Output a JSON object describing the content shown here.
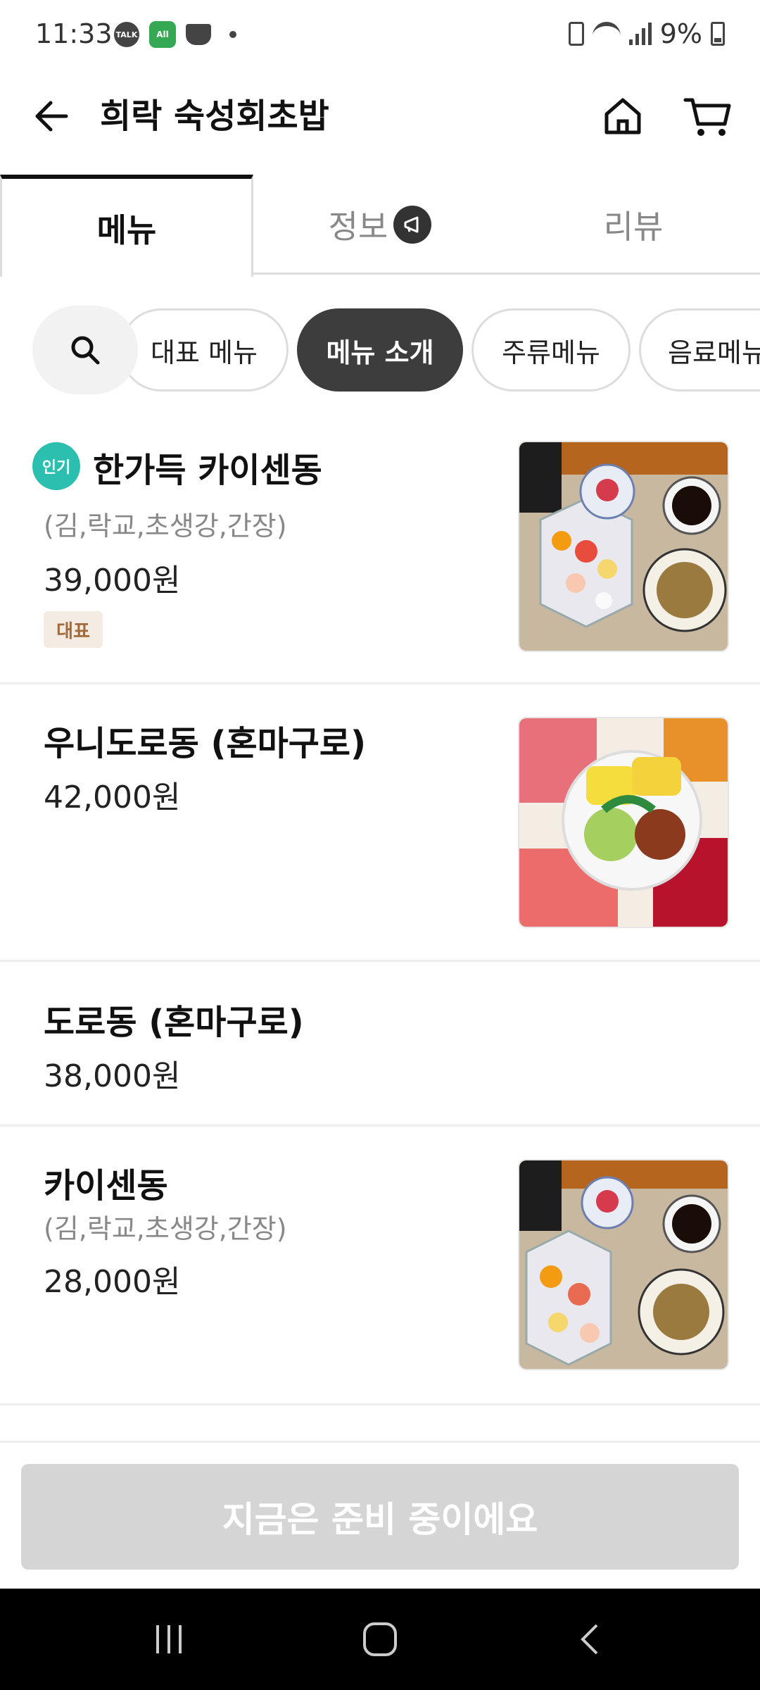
{
  "status_bar": {
    "time": "11:33",
    "talk_label": "TALK",
    "app_label": "All",
    "battery": "9%",
    "icons": [
      "talk-icon",
      "app-icon",
      "coffee-icon",
      "dot-icon",
      "battery-saver-icon",
      "wifi-icon",
      "signal-icon",
      "battery-icon"
    ]
  },
  "header": {
    "title": "희락 숙성회초밥",
    "icons": [
      "back-arrow-icon",
      "home-icon",
      "cart-icon"
    ]
  },
  "tabs": [
    {
      "label": "메뉴",
      "active": true
    },
    {
      "label": "정보",
      "active": false,
      "icon": "megaphone-icon"
    },
    {
      "label": "리뷰",
      "active": false
    }
  ],
  "chips": {
    "search_icon": "search-icon",
    "items": [
      {
        "label": "대표 메뉴",
        "active": false
      },
      {
        "label": "메뉴 소개",
        "active": true
      },
      {
        "label": "주류메뉴",
        "active": false
      },
      {
        "label": "음료메뉴",
        "active": false
      }
    ]
  },
  "menu": [
    {
      "badge": "인기",
      "name": "한가득 카이센동",
      "desc": "(김,락교,초생강,간장)",
      "price": "39,000원",
      "tag": "대표",
      "has_image": true
    },
    {
      "name": "우니도로동 (혼마구로)",
      "price": "42,000원",
      "has_image": true
    },
    {
      "name": "도로동 (혼마구로)",
      "price": "38,000원",
      "has_image": false
    },
    {
      "name": "카이센동",
      "desc": "(김,락교,초생강,간장)",
      "price": "28,000원",
      "has_image": true
    }
  ],
  "bottom_button": "지금은 준비 중이에요",
  "colors": {
    "accent_dark": "#3d3d3d",
    "popular_badge": "#2cbfb0",
    "tag_bg": "#f4ece2",
    "tag_text": "#a06a3c",
    "disabled_button": "#d5d5d5"
  }
}
